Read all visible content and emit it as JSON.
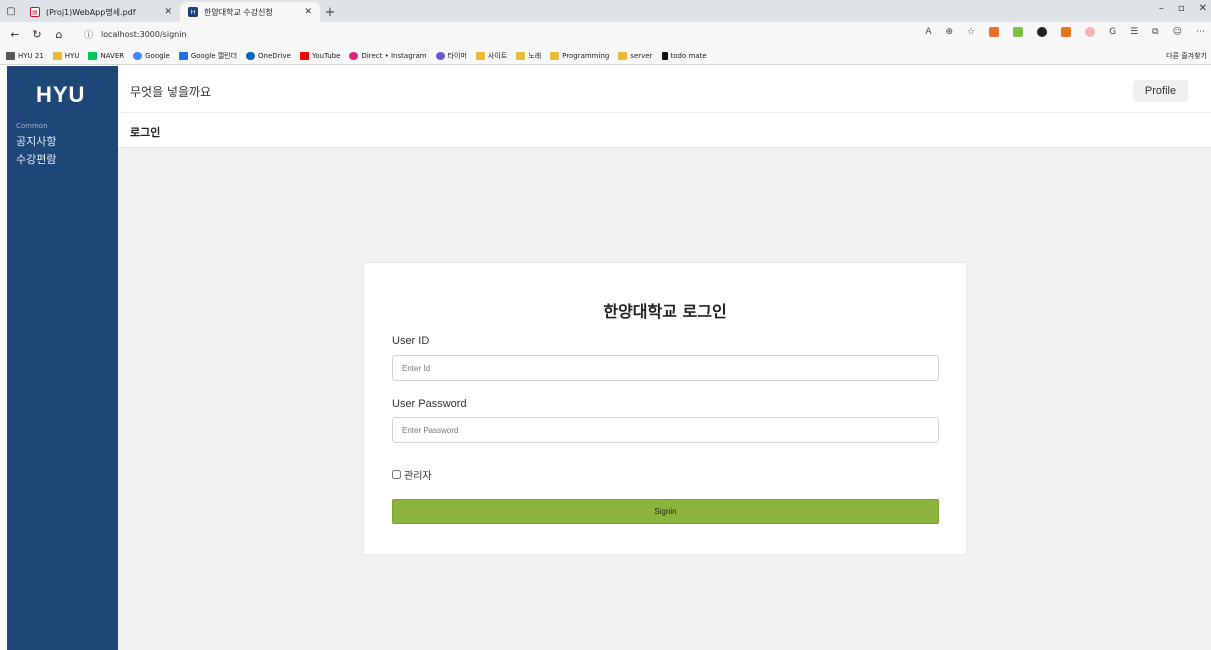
{
  "browser": {
    "tabs": [
      {
        "title": "(Proj1)WebApp명세.pdf",
        "icon": "pdf-icon"
      },
      {
        "title": "한양대학교 수강신청",
        "icon": "hyu-favicon"
      }
    ],
    "url": "localhost:3000/signin",
    "bookmarks": [
      "HYU 21",
      "HYU",
      "NAVER",
      "Google",
      "Google 캘린더",
      "OneDrive",
      "YouTube",
      "Direct • Instagram",
      "타이머",
      "사이트",
      "노래",
      "Programming",
      "server",
      "todo mate"
    ],
    "other_bookmarks": "다른 즐겨찾기"
  },
  "sidebar": {
    "logo": "HYU",
    "section": "Common",
    "items": [
      {
        "label": "공지사항"
      },
      {
        "label": "수강편람"
      }
    ]
  },
  "header": {
    "title": "무엇을 넣을까요",
    "profile_label": "Profile"
  },
  "subheader": {
    "title": "로그인"
  },
  "login": {
    "title": "한양대학교 로그인",
    "user_id_label": "User ID",
    "user_id_placeholder": "Enter Id",
    "user_id_value": "",
    "password_label": "User Password",
    "password_placeholder": "Enter Password",
    "password_value": "",
    "admin_label": "관리자",
    "submit_label": "Signin"
  },
  "colors": {
    "sidebar": "#1e4778",
    "button": "#8ab43e",
    "content_bg": "#f2f2f2"
  }
}
